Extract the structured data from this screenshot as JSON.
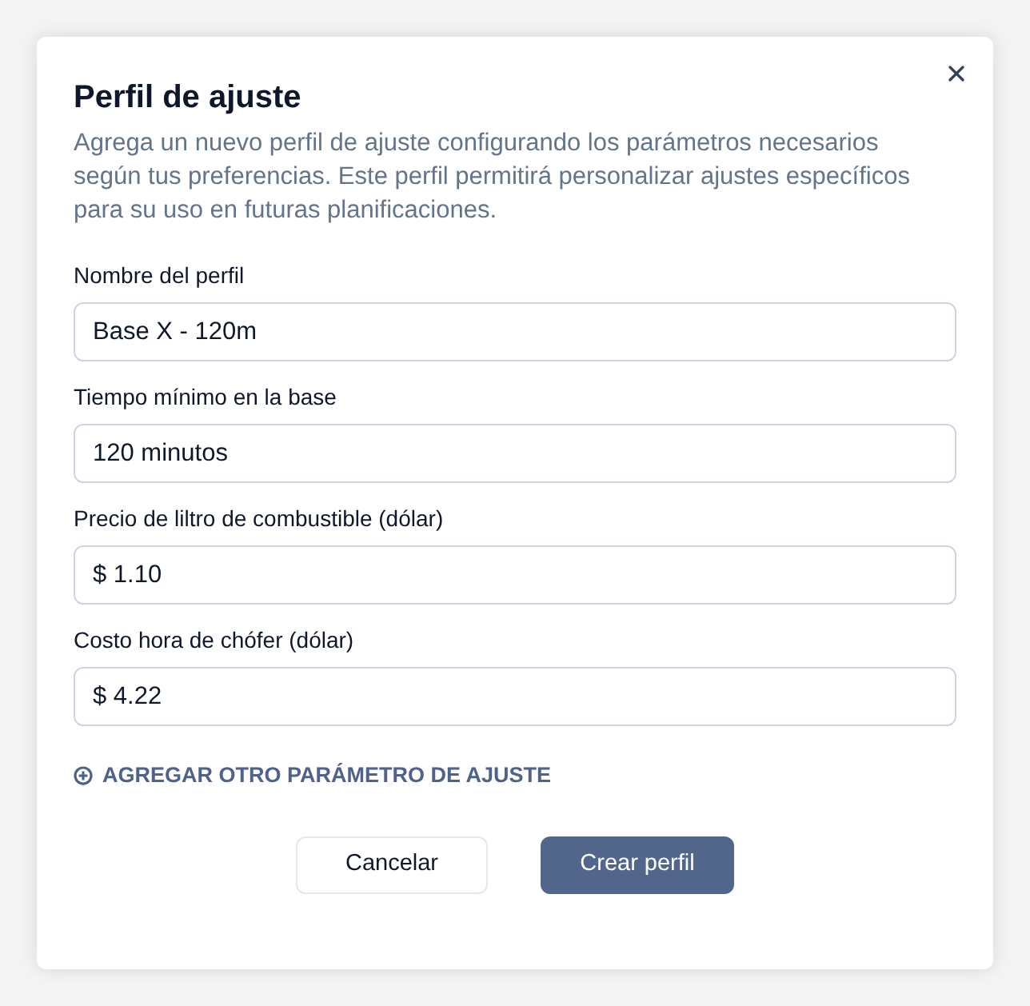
{
  "dialog": {
    "title": "Perfil de ajuste",
    "description": "Agrega un nuevo perfil de ajuste configurando los parámetros necesarios según tus preferencias. Este perfil permitirá personalizar ajustes específicos para su uso en futuras planificaciones.",
    "fields": [
      {
        "label": "Nombre del perfil",
        "value": "Base X - 120m"
      },
      {
        "label": "Tiempo mínimo en la base",
        "value": "120 minutos"
      },
      {
        "label": "Precio de liltro de combustible (dólar)",
        "value": "$ 1.10"
      },
      {
        "label": "Costo hora de chófer (dólar)",
        "value": "$ 4.22"
      }
    ],
    "add_link": "AGREGAR OTRO PARÁMETRO DE AJUSTE",
    "buttons": [
      {
        "label": "Cancelar",
        "kind": "secondary"
      },
      {
        "label": "Crear perfil",
        "kind": "primary"
      }
    ]
  }
}
